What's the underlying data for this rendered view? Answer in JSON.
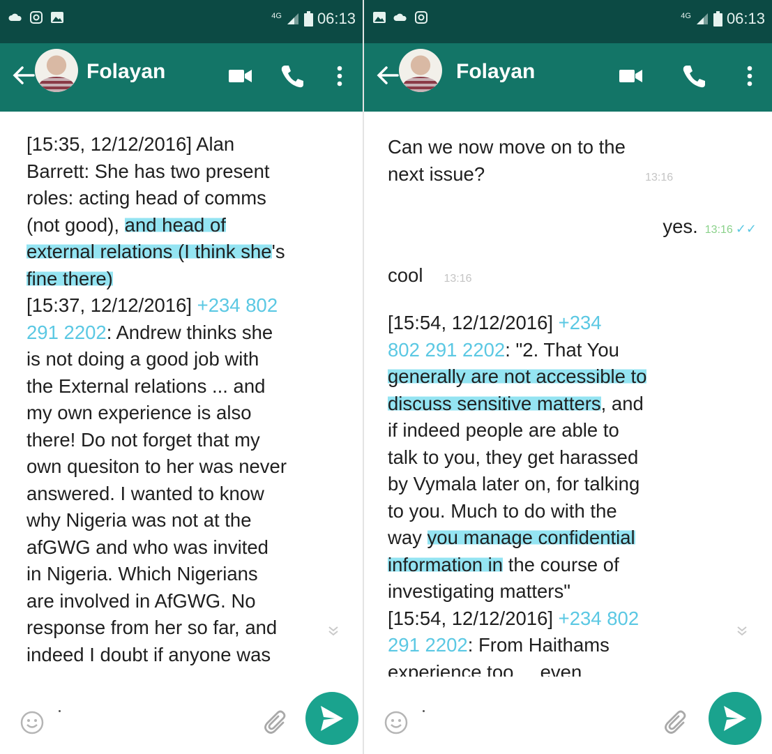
{
  "left": {
    "status": {
      "time": "06:13",
      "network": "4G"
    },
    "contact": {
      "name": "Folayan"
    },
    "lines": [
      [
        {
          "t": "[15:35, 12/12/2016] Alan"
        }
      ],
      [
        {
          "t": "Barrett: She has two present"
        }
      ],
      [
        {
          "t": "roles: acting head of comms"
        }
      ],
      [
        {
          "t": "(not good), "
        },
        {
          "t": "and head of",
          "hl": true
        }
      ],
      [
        {
          "t": "external relations (I think she",
          "hl": true
        },
        {
          "t": "'s"
        }
      ],
      [
        {
          "t": "fine there)",
          "hl": true
        }
      ],
      [
        {
          "t": "[15:37, 12/12/2016] "
        },
        {
          "t": "+234 802",
          "phone": true
        }
      ],
      [
        {
          "t": "291 2202",
          "phone": true
        },
        {
          "t": ": Andrew thinks she"
        }
      ],
      [
        {
          "t": "is not doing a good job with"
        }
      ],
      [
        {
          "t": "the External relations ... and"
        }
      ],
      [
        {
          "t": "my own experience is also"
        }
      ],
      [
        {
          "t": "there! Do not forget that my"
        }
      ],
      [
        {
          "t": "own quesiton to her was never"
        }
      ],
      [
        {
          "t": "answered. I wanted to know"
        }
      ],
      [
        {
          "t": "why Nigeria was not at the"
        }
      ],
      [
        {
          "t": "afGWG and who was invited"
        }
      ],
      [
        {
          "t": "in Nigeria. Which Nigerians"
        }
      ],
      [
        {
          "t": "are involved in AfGWG.  No"
        }
      ],
      [
        {
          "t": "response from her so far, and"
        }
      ],
      [
        {
          "t": "indeed I doubt if anyone was"
        }
      ]
    ]
  },
  "right": {
    "status": {
      "time": "06:13",
      "network": "4G"
    },
    "contact": {
      "name": "Folayan"
    },
    "msg1": {
      "line1": "Can we now move on to the",
      "line2": "next issue?",
      "time": "13:16"
    },
    "msg2": {
      "text": "yes.",
      "time": "13:16"
    },
    "msg3": {
      "text": "cool",
      "time": "13:16"
    },
    "lines": [
      [
        {
          "t": "[15:54, 12/12/2016] "
        },
        {
          "t": "+234",
          "phone": true
        }
      ],
      [
        {
          "t": "802 291 2202",
          "phone": true
        },
        {
          "t": ": \"2. That You"
        }
      ],
      [
        {
          "t": "generally are not accessible to",
          "hl": true
        }
      ],
      [
        {
          "t": "discuss sensitive matters",
          "hl": true
        },
        {
          "t": ", and"
        }
      ],
      [
        {
          "t": "if indeed people are able to"
        }
      ],
      [
        {
          "t": "talk to you, they get harassed"
        }
      ],
      [
        {
          "t": "by Vymala later on, for talking"
        }
      ],
      [
        {
          "t": "to you. Much to do with the"
        }
      ],
      [
        {
          "t": "way "
        },
        {
          "t": "you manage confidential",
          "hl": true
        }
      ],
      [
        {
          "t": "information in",
          "hl": true
        },
        {
          "t": " the course of"
        }
      ],
      [
        {
          "t": "investigating matters\""
        }
      ],
      [
        {
          "t": "[15:54, 12/12/2016] "
        },
        {
          "t": "+234 802",
          "phone": true
        }
      ],
      [
        {
          "t": "291 2202",
          "phone": true
        },
        {
          "t": ": From Haithams"
        }
      ],
      [
        {
          "t": "experience too.... even"
        }
      ]
    ]
  }
}
